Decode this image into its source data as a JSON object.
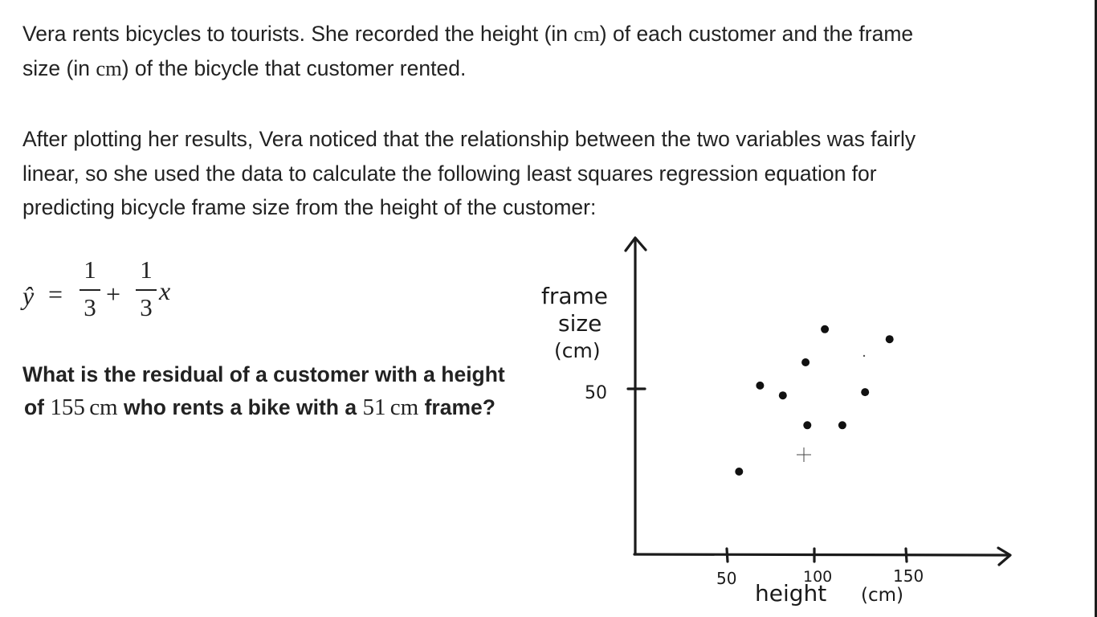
{
  "problem": {
    "intro_line1_a": "Vera rents bicycles to tourists. She recorded the height (in ",
    "unit_cm": "cm",
    "intro_line1_b": ") of each customer and the frame",
    "intro_line2_a": "size (in ",
    "intro_line2_b": ") of the bicycle that customer rented.",
    "context_line1": "After plotting her results, Vera noticed that the relationship between the two variables was fairly",
    "context_line2": "linear, so she used the data to calculate the following least squares regression equation for",
    "context_line3": "predicting bicycle frame size from the height of the customer:"
  },
  "equation": {
    "lhs": "ŷ",
    "equals": "=",
    "frac1_num": "1",
    "frac1_den": "3",
    "plus": "+",
    "frac2_num": "1",
    "frac2_den": "3",
    "variable": "x"
  },
  "question": {
    "line1": "What is the residual of a customer with a height",
    "line2_a": "of ",
    "height_value": "155",
    "unit": "cm",
    "line2_b": " who rents a bike with a ",
    "frame_value": "51",
    "line2_c": " frame?"
  },
  "sketch": {
    "y_label_line1": "frame",
    "y_label_line2": "size",
    "y_label_line3": "(cm)",
    "y_tick_label": "50",
    "x_tick_labels": [
      "50",
      "100",
      "150"
    ],
    "x_label": "height",
    "x_unit": "(cm)"
  },
  "chart_data": {
    "type": "scatter",
    "xlabel": "height (cm)",
    "ylabel": "frame size (cm)",
    "xlim": [
      0,
      210
    ],
    "ylim": [
      0,
      70
    ],
    "x_ticks": [
      50,
      100,
      150
    ],
    "y_ticks": [
      50
    ],
    "grid": false,
    "points": [
      {
        "x": 57,
        "y": 25
      },
      {
        "x": 69,
        "y": 51
      },
      {
        "x": 82,
        "y": 48
      },
      {
        "x": 95,
        "y": 58
      },
      {
        "x": 96,
        "y": 39
      },
      {
        "x": 106,
        "y": 68
      },
      {
        "x": 116,
        "y": 39
      },
      {
        "x": 129,
        "y": 49
      },
      {
        "x": 143,
        "y": 65
      }
    ]
  }
}
